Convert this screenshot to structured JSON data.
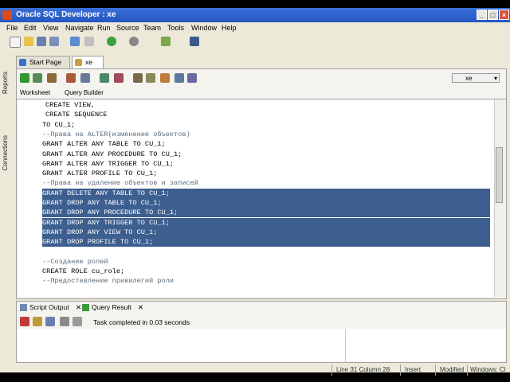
{
  "window": {
    "title": "Oracle SQL Developer : xe"
  },
  "menu": [
    "File",
    "Edit",
    "View",
    "Navigate",
    "Run",
    "Source",
    "Team",
    "Tools",
    "Window",
    "Help"
  ],
  "side_tabs": [
    "Reports",
    "Connections"
  ],
  "doc_tabs": [
    "Start Page",
    "xe"
  ],
  "connection_selector": "xe",
  "editor_subtabs": [
    "Worksheet",
    "Query Builder"
  ],
  "code_lines": [
    {
      "text": "CREATE VIEW,",
      "type": "normal"
    },
    {
      "text": "CREATE SEQUENCE",
      "type": "normal"
    },
    {
      "text": "TO CU_1;",
      "type": "normal"
    },
    {
      "text": "--Права на ALTER(изменение объектов)",
      "type": "comment"
    },
    {
      "text": "GRANT ALTER ANY TABLE TO CU_1;",
      "type": "normal"
    },
    {
      "text": "GRANT ALTER ANY PROCEDURE TO CU_1;",
      "type": "normal"
    },
    {
      "text": "GRANT ALTER ANY TRIGGER TO CU_1;",
      "type": "normal"
    },
    {
      "text": "GRANT ALTER PROFILE TO CU_1;",
      "type": "normal"
    },
    {
      "text": "--Права на удаление объектов и записей",
      "type": "comment"
    },
    {
      "text": "GRANT DELETE ANY TABLE TO CU_1;",
      "type": "selected"
    },
    {
      "text": "GRANT DROP ANY TABLE TO CU_1;",
      "type": "selected"
    },
    {
      "text": "GRANT DROP ANY PROCEDURE TO CU_1;",
      "type": "selected"
    },
    {
      "text": "GRANT DROP ANY TRIGGER TO CU_1;",
      "type": "selected"
    },
    {
      "text": "GRANT DROP ANY VIEW TO CU_1;",
      "type": "selected"
    },
    {
      "text": "GRANT DROP PROFILE TO CU_1;",
      "type": "selected"
    },
    {
      "text": "",
      "type": "normal"
    },
    {
      "text": "--Создание ролей",
      "type": "comment"
    },
    {
      "text": "CREATE ROLE cu_role;",
      "type": "normal"
    },
    {
      "text": "--Предоставление привилегий роли",
      "type": "comment"
    }
  ],
  "output_tabs": [
    "Script Output",
    "Query Result"
  ],
  "output_status": "Task completed in 0.03 seconds",
  "status": {
    "position": "Line 31 Column 28",
    "mode": "Insert",
    "modified": "Modified",
    "os": "Windows: Cl"
  }
}
